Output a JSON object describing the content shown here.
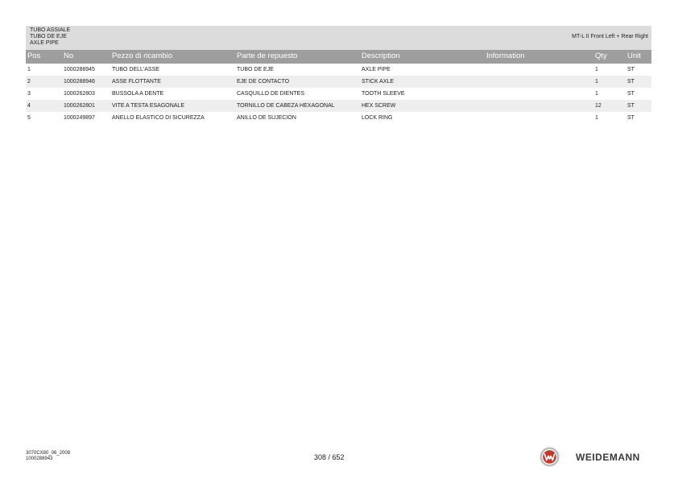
{
  "header": {
    "titles": [
      "TUBO ASSIALE",
      "TUBO DE EJE",
      "AXLE PIPE"
    ],
    "model": "MT-L II Front Left + Rear Right"
  },
  "table": {
    "columns": {
      "pos": "Pos",
      "no": "No",
      "it": "Pezzo di ricambio",
      "es": "Parte de repuesto",
      "en": "Description",
      "info": "Information",
      "qty": "Qty",
      "unit": "Unit"
    },
    "rows": [
      {
        "pos": "1",
        "no": "1000288945",
        "it": "TUBO DELL'ASSE",
        "es": "TUBO DE EJE",
        "en": "AXLE PIPE",
        "info": "",
        "qty": "1",
        "unit": "ST"
      },
      {
        "pos": "2",
        "no": "1000288946",
        "it": "ASSE FLOTTANTE",
        "es": "EJE DE CONTACTO",
        "en": "STICK AXLE",
        "info": "",
        "qty": "1",
        "unit": "ST"
      },
      {
        "pos": "3",
        "no": "1000262803",
        "it": "BUSSOLA A DENTE",
        "es": "CASQUILLO DE DIENTES",
        "en": "TOOTH SLEEVE",
        "info": "",
        "qty": "1",
        "unit": "ST"
      },
      {
        "pos": "4",
        "no": "1000262801",
        "it": "VITE A TESTA ESAGONALE",
        "es": "TORNILLO DE CABEZA HEXAGONAL",
        "en": "HEX SCREW",
        "info": "",
        "qty": "12",
        "unit": "ST"
      },
      {
        "pos": "5",
        "no": "1000249897",
        "it": "ANELLO ELASTICO DI SICUREZZA",
        "es": "ANILLO DE SUJECIÓN",
        "en": "LOCK RING",
        "info": "",
        "qty": "1",
        "unit": "ST"
      }
    ]
  },
  "footer": {
    "doc_code": "3070CX80_06_2008",
    "part_no": "1000288943",
    "page": "308 / 652",
    "brand": "WEIDEMANN",
    "brand_color": "#c0392b"
  }
}
